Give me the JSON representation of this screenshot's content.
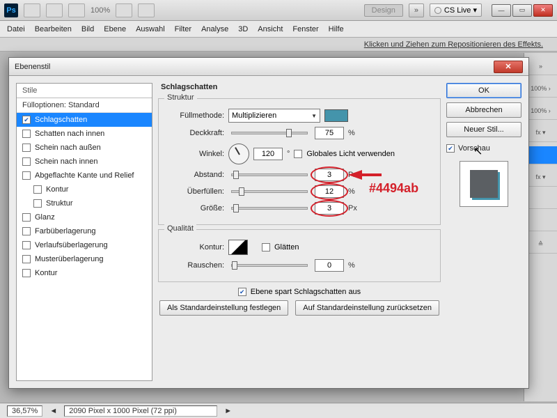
{
  "app": {
    "ps_label": "Ps",
    "zoom": "100%",
    "design_label": "Design",
    "cslive_label": "CS Live ▾",
    "hint": "Klicken und Ziehen zum Repositionieren des Effekts."
  },
  "menu": [
    "Datei",
    "Bearbeiten",
    "Bild",
    "Ebene",
    "Auswahl",
    "Filter",
    "Analyse",
    "3D",
    "Ansicht",
    "Fenster",
    "Hilfe"
  ],
  "panels": [
    "»",
    "100%  ›",
    "100%  ›",
    "fx ▾",
    "",
    "fx ▾",
    "",
    "",
    "≙",
    ""
  ],
  "status": {
    "zoom": "36,57%",
    "doc": "2090 Pixel x 1000 Pixel (72 ppi)"
  },
  "dialog": {
    "title": "Ebenenstil",
    "styles_head": "Stile",
    "fill_options": "Fülloptionen: Standard",
    "styles": [
      {
        "label": "Schlagschatten",
        "checked": true,
        "selected": true
      },
      {
        "label": "Schatten nach innen",
        "checked": false
      },
      {
        "label": "Schein nach außen",
        "checked": false
      },
      {
        "label": "Schein nach innen",
        "checked": false
      },
      {
        "label": "Abgeflachte Kante und Relief",
        "checked": false
      },
      {
        "label": "Kontur",
        "checked": false,
        "indent": true
      },
      {
        "label": "Struktur",
        "checked": false,
        "indent": true
      },
      {
        "label": "Glanz",
        "checked": false
      },
      {
        "label": "Farbüberlagerung",
        "checked": false
      },
      {
        "label": "Verlaufsüberlagerung",
        "checked": false
      },
      {
        "label": "Musterüberlagerung",
        "checked": false
      },
      {
        "label": "Kontur",
        "checked": false
      }
    ],
    "section": "Schlagschatten",
    "struct_title": "Struktur",
    "fill_label": "Füllmethode:",
    "fill_value": "Multiplizieren",
    "opacity_label": "Deckkraft:",
    "opacity_value": "75",
    "opacity_unit": "%",
    "angle_label": "Winkel:",
    "angle_value": "120",
    "angle_unit": "°",
    "global_light": "Globales Licht verwenden",
    "dist_label": "Abstand:",
    "dist_value": "3",
    "dist_unit": "Px",
    "spread_label": "Überfüllen:",
    "spread_value": "12",
    "spread_unit": "%",
    "size_label": "Größe:",
    "size_value": "3",
    "size_unit": "Px",
    "quality_title": "Qualität",
    "contour_label": "Kontur:",
    "antialias": "Glätten",
    "noise_label": "Rauschen:",
    "noise_value": "0",
    "noise_unit": "%",
    "knockout": "Ebene spart Schlagschatten aus",
    "make_default": "Als Standardeinstellung festlegen",
    "reset_default": "Auf Standardeinstellung zurücksetzen",
    "ok": "OK",
    "cancel": "Abbrechen",
    "new_style": "Neuer Stil...",
    "preview": "Vorschau"
  },
  "annotation": "#4494ab"
}
